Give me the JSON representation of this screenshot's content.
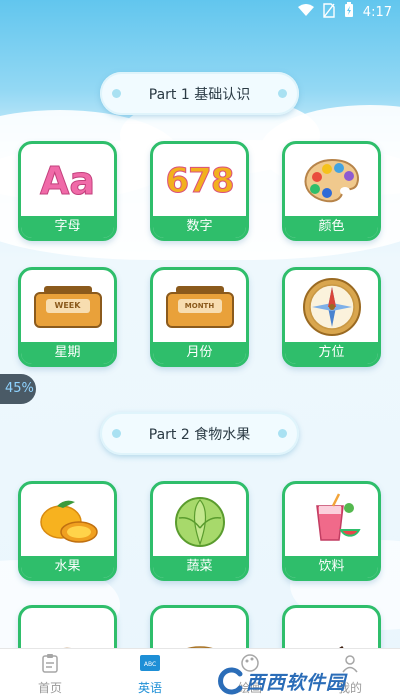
{
  "status_bar": {
    "time": "4:17"
  },
  "sections": [
    {
      "title": "Part 1 基础认识"
    },
    {
      "title": "Part 2 食物水果"
    }
  ],
  "cards": [
    {
      "label": "字母",
      "art_text": "Aa"
    },
    {
      "label": "数字",
      "art_text": "678"
    },
    {
      "label": "颜色"
    },
    {
      "label": "星期",
      "art_text": "WEEK"
    },
    {
      "label": "月份",
      "art_text": "MONTH"
    },
    {
      "label": "方位"
    },
    {
      "label": "水果"
    },
    {
      "label": "蔬菜"
    },
    {
      "label": "饮料"
    },
    {
      "label": ""
    },
    {
      "label": ""
    },
    {
      "label": ""
    }
  ],
  "float_badge": "45%",
  "tabs": [
    {
      "label": "首页",
      "icon": "clipboard-icon"
    },
    {
      "label": "英语",
      "icon": "abc-book-icon"
    },
    {
      "label": "绘画",
      "icon": "palette-icon"
    },
    {
      "label": "我的",
      "icon": "user-icon"
    }
  ],
  "watermark": "西西软件园",
  "colors": {
    "card_green": "#2fbe6b",
    "tab_active": "#1e8fd6",
    "sky": "#62c6ee"
  }
}
